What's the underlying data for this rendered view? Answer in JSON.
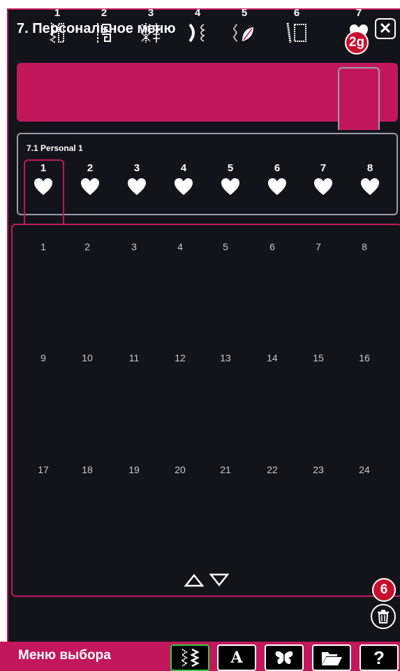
{
  "window": {
    "title": "7. Персональное меню",
    "close_label": "✕"
  },
  "callouts": {
    "tab_callout": "2g",
    "trash_callout": "6"
  },
  "categories": [
    {
      "number": "1",
      "icon": "stitch-zigzag-icon"
    },
    {
      "number": "2",
      "icon": "stitch-greek-key-icon"
    },
    {
      "number": "3",
      "icon": "stitch-lattice-icon"
    },
    {
      "number": "4",
      "icon": "stitch-scallop-icon"
    },
    {
      "number": "5",
      "icon": "stitch-leaf-icon"
    },
    {
      "number": "6",
      "icon": "stitch-frame-icon"
    },
    {
      "number": "7",
      "icon": "heart-icon",
      "selected": true
    }
  ],
  "subcategory": {
    "title": "7.1 Personal 1",
    "slots": [
      "1",
      "2",
      "3",
      "4",
      "5",
      "6",
      "7",
      "8"
    ],
    "selected_slot": "1"
  },
  "grid": {
    "cells": [
      "1",
      "2",
      "3",
      "4",
      "5",
      "6",
      "7",
      "8",
      "9",
      "10",
      "11",
      "12",
      "13",
      "14",
      "15",
      "16",
      "17",
      "18",
      "19",
      "20",
      "21",
      "22",
      "23",
      "24"
    ]
  },
  "bottom_bar": {
    "title": "Меню выбора",
    "buttons": [
      {
        "name": "stitch-menu-button",
        "icon": "stitch-icon"
      },
      {
        "name": "font-menu-button",
        "label": "A"
      },
      {
        "name": "embroidery-menu-button",
        "icon": "butterfly-icon"
      },
      {
        "name": "file-manager-button",
        "icon": "folder-icon"
      },
      {
        "name": "help-button",
        "label": "?"
      }
    ]
  },
  "colors": {
    "accent": "#c2185b",
    "background": "#12141a",
    "callout": "#c8102e"
  }
}
